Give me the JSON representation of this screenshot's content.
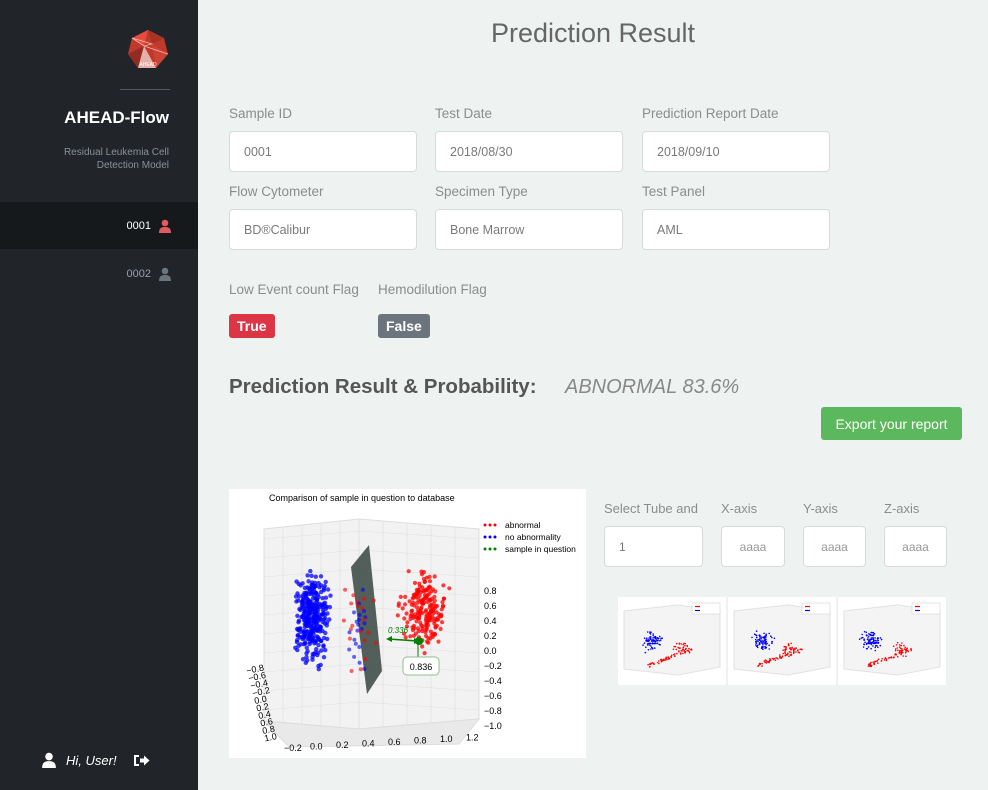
{
  "sidebar": {
    "app_name": "AHEAD-Flow",
    "subtitle": "Residual Leukemia Cell Detection Model",
    "items": [
      {
        "label": "0001",
        "active": true
      },
      {
        "label": "0002",
        "active": false
      }
    ],
    "user_greeting": "Hi, User!",
    "active_icon_color": "#e05c63",
    "inactive_icon_color": "#6c757d"
  },
  "page": {
    "title": "Prediction Result"
  },
  "fields": {
    "sample_id": {
      "label": "Sample ID",
      "value": "0001"
    },
    "test_date": {
      "label": "Test Date",
      "value": "2018/08/30"
    },
    "report_date": {
      "label": "Prediction Report Date",
      "value": "2018/09/10"
    },
    "cytometer": {
      "label": "Flow Cytometer",
      "value": "BD®Calibur"
    },
    "specimen": {
      "label": "Specimen Type",
      "value": "Bone Marrow"
    },
    "panel": {
      "label": "Test Panel",
      "value": "AML"
    }
  },
  "flags": {
    "low_event": {
      "label": "Low Event count Flag",
      "value": "True",
      "color": "#dc3545"
    },
    "hemodilution": {
      "label": "Hemodilution Flag",
      "value": "False",
      "color": "#6c757d"
    }
  },
  "result": {
    "title": "Prediction Result & Probability:",
    "value": "ABNORMAL 83.6%"
  },
  "export_button": "Export your report",
  "selectors": {
    "tube": {
      "label": "Select Tube and",
      "value": "1"
    },
    "x": {
      "label": "X-axis",
      "placeholder": "aaaa"
    },
    "y": {
      "label": "Y-axis",
      "placeholder": "aaaa"
    },
    "z": {
      "label": "Z-axis",
      "placeholder": "aaaa"
    }
  },
  "chart_data": {
    "type": "scatter",
    "title": "Comparison of sample in question to database",
    "legend_position": "top-right",
    "series": [
      {
        "name": "abnormal",
        "color": "#ff0000"
      },
      {
        "name": "no abnormality",
        "color": "#0000ff"
      },
      {
        "name": "sample in question",
        "color": "#008000"
      }
    ],
    "annotations": [
      "0.336",
      "0.836"
    ],
    "z_ticks": [
      "0.8",
      "0.6",
      "0.4",
      "0.2",
      "0.0",
      "−0.2",
      "−0.4",
      "−0.6",
      "−0.8",
      "−1.0"
    ],
    "x_ticks": [
      "−0.2",
      "0.0",
      "0.2",
      "0.4",
      "0.6",
      "0.8",
      "1.0",
      "1.2"
    ],
    "y_ticks": [
      "−0.8",
      "−0.6",
      "−0.4",
      "−0.2",
      "0.0",
      "0.2",
      "0.4",
      "0.6",
      "0.8",
      "1.0"
    ]
  }
}
